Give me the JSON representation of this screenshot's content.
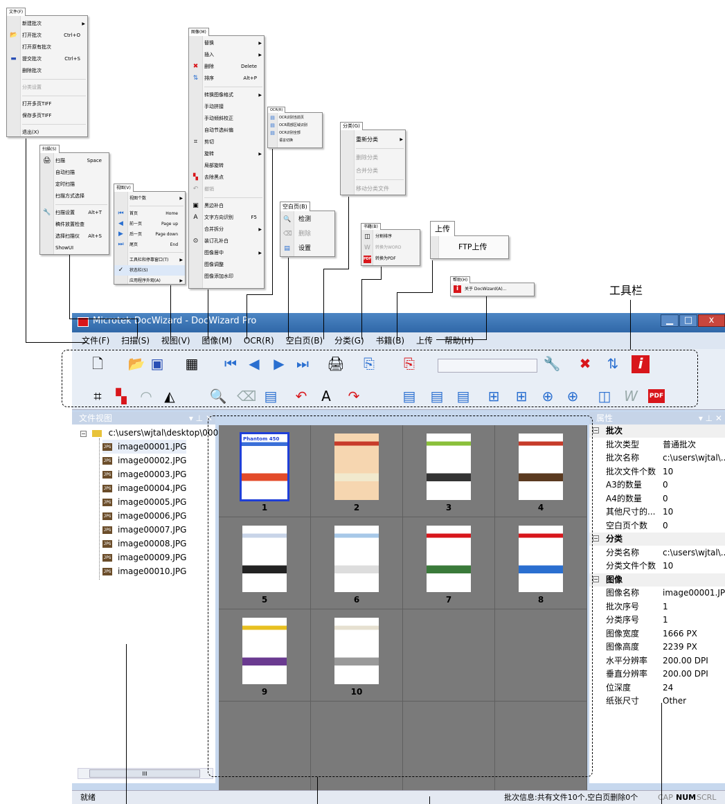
{
  "menus": {
    "file": {
      "title": "文件(F)",
      "items": [
        "新建批次",
        "打开批次",
        "打开原有批次",
        "提交批次",
        "删除批次",
        "分类设置",
        "打开多页TIFF",
        "保存多页TIFF",
        "退出(X)"
      ],
      "keys": {
        "open": "Ctrl+O",
        "submit": "Ctrl+S"
      }
    },
    "scan": {
      "title": "扫描(S)",
      "items": [
        "扫描",
        "自动扫描",
        "定时扫描",
        "扫描方式选择",
        "扫描设置",
        "稿件放置检查",
        "选择扫描仪",
        "ShowUI"
      ],
      "keys": {
        "scan": "Space",
        "settings": "Alt+T",
        "select": "Alt+S"
      }
    },
    "view": {
      "title": "视图(V)",
      "items": [
        "视图个数",
        "首页",
        "前一页",
        "后一页",
        "尾页",
        "工具栏和停靠窗口(T)",
        "状态栏(S)",
        "应用程序外观(A)"
      ],
      "keys": {
        "first": "Home",
        "prev": "Page up",
        "next": "Page down",
        "last": "End"
      }
    },
    "image": {
      "title": "图像(M)",
      "items": [
        "替换",
        "插入",
        "删除",
        "排序",
        "转换图像格式",
        "手动拼接",
        "手动倾斜校正",
        "自动节选纠偏",
        "剪切",
        "旋转",
        "局部旋转",
        "去除黑点",
        "撤销",
        "黑边补白",
        "文字方向识别",
        "合并拆分",
        "装订孔补白",
        "图像居中",
        "图像调整",
        "图像添加水印"
      ],
      "keys": {
        "delete": "Delete",
        "sort": "Alt+P",
        "textdir": "F5"
      }
    },
    "ocr": {
      "title": "OCR(R)",
      "items": [
        "OCR识别当前页",
        "OCR局部区域识别",
        "OCR识别全部",
        "语言切换"
      ]
    },
    "classify": {
      "title": "分类(G)",
      "items": [
        "重新分类",
        "删除分类",
        "合并分类",
        "移动分类文件"
      ]
    },
    "blank": {
      "title": "空白页(B)",
      "items": [
        "检测",
        "删除",
        "设置"
      ]
    },
    "book": {
      "title": "书籍(B)",
      "items": [
        "分割排序",
        "转换为WORD",
        "转换为PDF"
      ]
    },
    "upload": {
      "title": "上传",
      "items": [
        "FTP上传"
      ]
    },
    "help": {
      "title": "帮助(H)",
      "items": [
        "关于 DocWizard(A)..."
      ]
    }
  },
  "annotation": {
    "toolbar_label": "工具栏"
  },
  "window": {
    "title": "Microtek DocWizard - DocWizard Pro",
    "menubar": [
      "文件(F)",
      "扫描(S)",
      "视图(V)",
      "图像(M)",
      "OCR(R)",
      "空白页(B)",
      "分类(G)",
      "书籍(B)",
      "上传",
      "帮助(H)"
    ]
  },
  "file_view": {
    "title": "文件视图",
    "root": "c:\\users\\wjtal\\desktop\\0000",
    "files": [
      "image00001.JPG",
      "image00002.JPG",
      "image00003.JPG",
      "image00004.JPG",
      "image00005.JPG",
      "image00006.JPG",
      "image00007.JPG",
      "image00008.JPG",
      "image00009.JPG",
      "image00010.JPG"
    ],
    "scroll_glyph": "III"
  },
  "thumbnails": [
    "1",
    "2",
    "3",
    "4",
    "5",
    "6",
    "7",
    "8",
    "9",
    "10"
  ],
  "thumb_badge": "JPG",
  "thumb_cover": "Phantom 450",
  "properties": {
    "title": "属性",
    "groups": [
      {
        "name": "批次",
        "rows": [
          [
            "批次类型",
            "普通批次"
          ],
          [
            "批次名称",
            "c:\\users\\wjtal\\..."
          ],
          [
            "批次文件个数",
            "10"
          ],
          [
            "A3的数量",
            "0"
          ],
          [
            "A4的数量",
            "0"
          ],
          [
            "其他尺寸的...",
            "10"
          ],
          [
            "空白页个数",
            "0"
          ]
        ]
      },
      {
        "name": "分类",
        "rows": [
          [
            "分类名称",
            "c:\\users\\wjtal\\..."
          ],
          [
            "分类文件个数",
            "10"
          ]
        ]
      },
      {
        "name": "图像",
        "rows": [
          [
            "图像名称",
            "image00001.JPG"
          ],
          [
            "批次序号",
            "1"
          ],
          [
            "分类序号",
            "1"
          ],
          [
            "图像宽度",
            "1666 PX"
          ],
          [
            "图像高度",
            "2239 PX"
          ],
          [
            "水平分辨率",
            "200.00 DPI"
          ],
          [
            "垂直分辨率",
            "200.00 DPI"
          ],
          [
            "位深度",
            "24"
          ],
          [
            "纸张尺寸",
            "Other"
          ]
        ]
      }
    ]
  },
  "status": {
    "left": "就绪",
    "info": "批次信息:共有文件10个,空白页删除0个",
    "cap": "CAP",
    "num": "NUM",
    "scrl": "SCRL"
  },
  "colors": {
    "title": "#3b74b6",
    "accent": "#1f3fd8",
    "red": "#d8161b",
    "grid": "#7a7a7a"
  }
}
